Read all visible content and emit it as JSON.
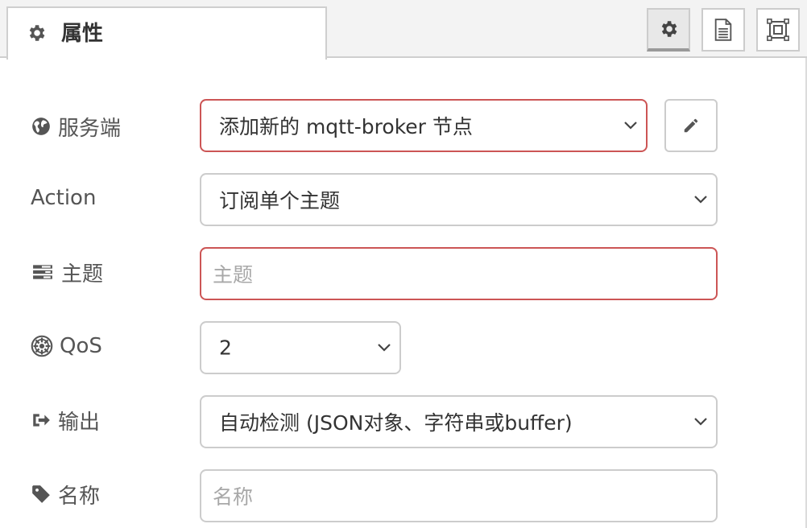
{
  "tabs": {
    "active_label": "属性",
    "active_icon": "gear-icon",
    "buttons": [
      {
        "name": "settings",
        "icon": "gear-icon",
        "active": true
      },
      {
        "name": "description",
        "icon": "document-icon",
        "active": false
      },
      {
        "name": "appearance",
        "icon": "frame-icon",
        "active": false
      }
    ]
  },
  "form": {
    "server": {
      "label": "服务端",
      "icon": "globe-icon",
      "value": "添加新的 mqtt-broker 节点",
      "edit_icon": "pencil-icon"
    },
    "action": {
      "label": "Action",
      "value": "订阅单个主题"
    },
    "topic": {
      "label": "主题",
      "icon": "tasks-icon",
      "placeholder": "主题",
      "value": ""
    },
    "qos": {
      "label": "QoS",
      "icon": "empire-icon",
      "value": "2"
    },
    "output": {
      "label": "输出",
      "icon": "sign-out-icon",
      "value": "自动检测 (JSON对象、字符串或buffer)"
    },
    "name": {
      "label": "名称",
      "icon": "tag-icon",
      "placeholder": "名称",
      "value": ""
    }
  },
  "colors": {
    "error_border": "#cc5555",
    "border": "#cccccc",
    "label": "#555555"
  }
}
